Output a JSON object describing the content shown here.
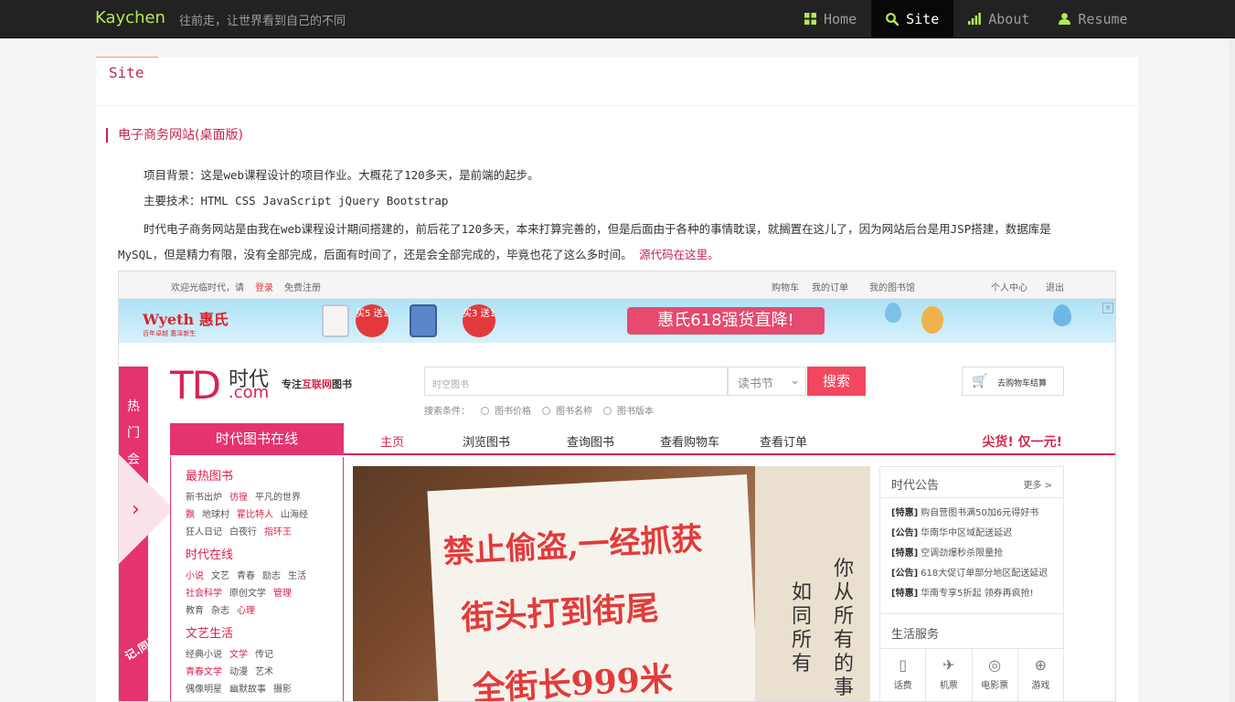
{
  "navbar": {
    "brand": "Kaychen",
    "slogan": "往前走，让世界看到自己的不同",
    "items": [
      {
        "label": "Home",
        "icon": "grid-icon",
        "active": false
      },
      {
        "label": "Site",
        "icon": "search-icon",
        "active": true
      },
      {
        "label": "About",
        "icon": "signal-icon",
        "active": false
      },
      {
        "label": "Resume",
        "icon": "user-icon",
        "active": false
      }
    ]
  },
  "page": {
    "tab": "Site",
    "section_title": "电子商务网站(桌面版)",
    "background": "项目背景：这是web课程设计的项目作业。大概花了120多天，是前端的起步。",
    "tech": "主要技术：HTML CSS JavaScript jQuery Bootstrap",
    "description": "时代电子商务网站是由我在web课程设计期间搭建的，前后花了120多天，本来打算完善的，但是后面由于各种的事情耽误，就搁置在这儿了，因为网站后台是用JSP搭建，数据库是MySQL，但是精力有限，没有全部完成，后面有时间了，还是会全部完成的，毕竟也花了这么多时间。",
    "source_link": "源代码在这里。",
    "accent_color": "#c7254e"
  },
  "shot": {
    "top": {
      "welcome": "欢迎光临时代，请",
      "login": "登录",
      "register": "免费注册",
      "cart": "购物车",
      "orders": "我的订单",
      "books": "我的图书馆",
      "personal": "个人中心",
      "logout": "退出"
    },
    "banner": {
      "brand": "Wyeth 惠氏",
      "tagline": "百年卓越 惠泽新生",
      "offer1": "买5 送1",
      "offer2": "买3 送1",
      "promo": "惠氏618强货直降!"
    },
    "side": {
      "text": "热门会场",
      "note": "记.同阅读"
    },
    "logo": {
      "td": "TD",
      "cn": "时代",
      "com": ".com",
      "slogan_pre": "专注",
      "slogan_hl": "互联网",
      "slogan_post": "图书"
    },
    "search": {
      "placeholder": "时空图书",
      "category": "读书节",
      "button": "搜索",
      "conditions_label": "搜索条件：",
      "options": [
        "图书价格",
        "图书名称",
        "图书版本"
      ],
      "cart_btn": "去购物车结算"
    },
    "nav": {
      "head": "时代图书在线",
      "items": [
        "主页",
        "浏览图书",
        "查询图书",
        "查看购物车",
        "查看订单"
      ],
      "hot": "尖货! 仅一元!"
    },
    "categories": [
      {
        "title": "最热图书",
        "rows": [
          [
            "新书出炉",
            "彷徨",
            "平凡的世界"
          ],
          [
            "飘",
            "地球村",
            "霍比特人",
            "山海经"
          ],
          [
            "狂人日记",
            "白夜行",
            "指环王"
          ]
        ]
      },
      {
        "title": "时代在线",
        "rows": [
          [
            "小说",
            "文艺",
            "青春",
            "励志",
            "生活"
          ],
          [
            "社会科学",
            "原创文学",
            "管理"
          ],
          [
            "教育",
            "杂志",
            "心理"
          ]
        ]
      },
      {
        "title": "文艺生活",
        "rows": [
          [
            "经典小说",
            "文学",
            "传记"
          ],
          [
            "青春文学",
            "动漫",
            "艺术"
          ],
          [
            "偶像明星",
            "幽默故事",
            "摄影"
          ]
        ]
      }
    ],
    "photo_text": {
      "line1": "禁止偷盗,一经抓获",
      "line2": "街头打到街尾",
      "line3": "全街长999米",
      "side1": "如同所有",
      "side2": "你从所有的事"
    },
    "notice": {
      "title": "时代公告",
      "more": "更多 >",
      "items": [
        {
          "tag": "[特惠]",
          "text": "购自营图书满50加6元得好书"
        },
        {
          "tag": "[公告]",
          "text": "华南华中区域配送延迟"
        },
        {
          "tag": "[特惠]",
          "text": "空调劲爆秒杀限量抢"
        },
        {
          "tag": "[公告]",
          "text": "618大促订单部分地区配送延迟"
        },
        {
          "tag": "[特惠]",
          "text": "华南专享5折起 领券再疯抢!"
        }
      ],
      "life_title": "生活服务",
      "life": [
        "话费",
        "机票",
        "电影票",
        "游戏"
      ]
    }
  }
}
